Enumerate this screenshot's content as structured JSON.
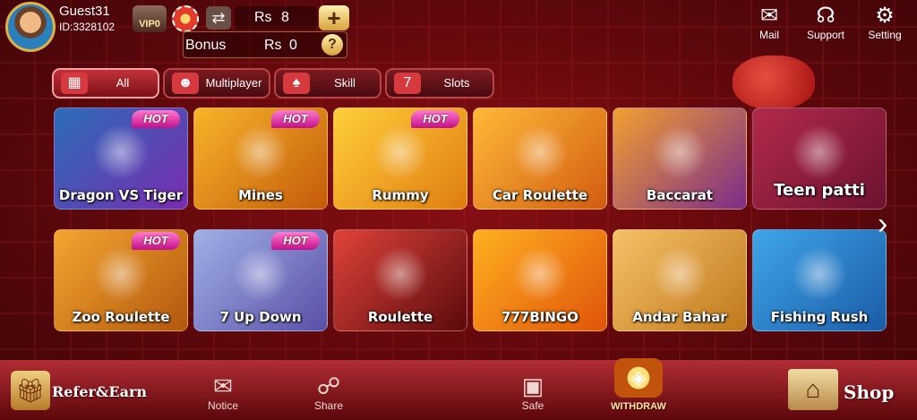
{
  "user": {
    "name": "Guest31",
    "id": "ID:3328102",
    "vip": "VIP0"
  },
  "wallet": {
    "currency": "Rs",
    "balance": "8",
    "bonus_label": "Bonus",
    "bonus_currency": "Rs",
    "bonus_amount": "0"
  },
  "top_icons": [
    {
      "label": "Mail",
      "icon": "mail-icon"
    },
    {
      "label": "Support",
      "icon": "headset-icon"
    },
    {
      "label": "Setting",
      "icon": "gear-icon"
    }
  ],
  "tabs": [
    {
      "label": "All",
      "icon": "grid-icon",
      "active": true
    },
    {
      "label": "Multiplayer",
      "icon": "people-icon",
      "active": false
    },
    {
      "label": "Skill",
      "icon": "cards-icon",
      "active": false
    },
    {
      "label": "Slots",
      "icon": "slot-machine-icon",
      "active": false
    }
  ],
  "games_row1": [
    {
      "name": "Dragon VS Tiger",
      "hot": "HOT",
      "colors": [
        "#2b6db8",
        "#7a2bb0"
      ]
    },
    {
      "name": "Mines",
      "hot": "HOT",
      "colors": [
        "#f6b52a",
        "#c55a0a"
      ]
    },
    {
      "name": "Rummy",
      "hot": "HOT",
      "colors": [
        "#ffcf3a",
        "#e07c10"
      ]
    },
    {
      "name": "Car Roulette",
      "hot": "",
      "colors": [
        "#ffb938",
        "#d25c11"
      ]
    },
    {
      "name": "Baccarat",
      "hot": "",
      "colors": [
        "#f1a030",
        "#7d2b8a"
      ]
    },
    {
      "name": "Teen patti",
      "hot": "",
      "colors": [
        "#b32a4a",
        "#6c1230"
      ]
    }
  ],
  "games_row2": [
    {
      "name": "Zoo Roulette",
      "hot": "HOT",
      "colors": [
        "#f4a630",
        "#b2570e"
      ]
    },
    {
      "name": "7 Up Down",
      "hot": "HOT",
      "colors": [
        "#9fb0e6",
        "#5a4fa8"
      ]
    },
    {
      "name": "Roulette",
      "hot": "",
      "colors": [
        "#e0433a",
        "#5a0a0c"
      ]
    },
    {
      "name": "777BINGO",
      "hot": "",
      "colors": [
        "#ffb020",
        "#e0540a"
      ]
    },
    {
      "name": "Andar Bahar",
      "hot": "",
      "colors": [
        "#f7c167",
        "#c0781c"
      ]
    },
    {
      "name": "Fishing Rush",
      "hot": "",
      "colors": [
        "#3fa6e8",
        "#1b5ba8"
      ]
    }
  ],
  "bottom_nav": {
    "refer": "Refer&Earn",
    "notice": "Notice",
    "share": "Share",
    "safe": "Safe",
    "withdraw": "WITHDRAW",
    "shop": "Shop"
  }
}
